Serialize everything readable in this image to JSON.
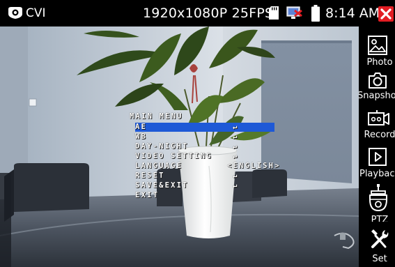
{
  "statusbar": {
    "app_title": "CVI",
    "resolution": "1920x1080P 25FPS",
    "time": "8:14 AM"
  },
  "osd_menu": {
    "title": "MAIN MENU",
    "items": [
      {
        "label": "AE",
        "value": "↵",
        "selected": true
      },
      {
        "label": "WB",
        "value": "↵",
        "selected": false
      },
      {
        "label": "DAY-NIGHT",
        "value": "↵",
        "selected": false
      },
      {
        "label": "VIDEO SETTING",
        "value": "↵",
        "selected": false
      },
      {
        "label": "LANGUAGE",
        "value": "<ENGLISH>",
        "selected": false
      },
      {
        "label": "RESET",
        "value": "↵",
        "selected": false
      },
      {
        "label": "SAVE&EXIT",
        "value": "↵",
        "selected": false
      },
      {
        "label": "EXIT",
        "value": "",
        "selected": false
      }
    ]
  },
  "sidebar": {
    "items": [
      {
        "label": "Photo",
        "icon": "photo-icon"
      },
      {
        "label": "Snapshot",
        "icon": "camera-icon"
      },
      {
        "label": "Record",
        "icon": "video-record-icon"
      },
      {
        "label": "Playback",
        "icon": "play-icon"
      },
      {
        "label": "PTZ",
        "icon": "ptz-dome-icon"
      },
      {
        "label": "Set",
        "icon": "tools-icon"
      }
    ]
  },
  "colors": {
    "close_button": "#e21d23",
    "osd_highlight": "#1e59d6",
    "background": "#000000"
  }
}
